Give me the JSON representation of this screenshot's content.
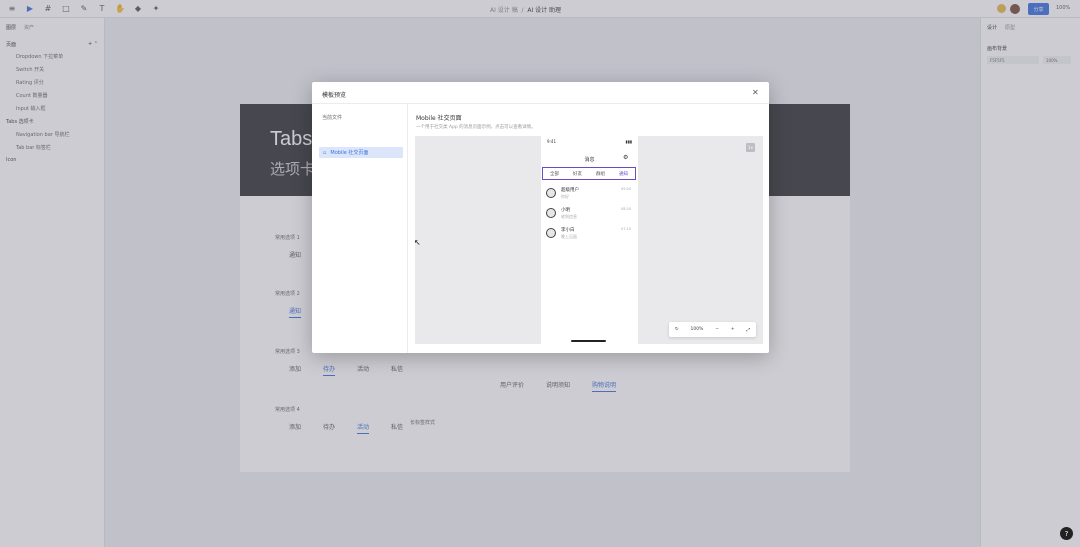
{
  "topbar": {
    "tools": [
      {
        "name": "menu-icon",
        "glyph": "≡"
      },
      {
        "name": "move-tool-icon",
        "glyph": "▶"
      },
      {
        "name": "frame-tool-icon",
        "glyph": "#"
      },
      {
        "name": "shape-tool-icon",
        "glyph": "□"
      },
      {
        "name": "pen-tool-icon",
        "glyph": "✎"
      },
      {
        "name": "text-tool-icon",
        "glyph": "T"
      },
      {
        "name": "hand-tool-icon",
        "glyph": "✋"
      },
      {
        "name": "component-tool-icon",
        "glyph": "◆"
      },
      {
        "name": "plugin-tool-icon",
        "glyph": "✦"
      }
    ],
    "doc_path": "AI 设计 稿",
    "doc_name": "AI 设计 助理",
    "share_label": "分享",
    "zoom": "100%"
  },
  "left_panel": {
    "tabs": [
      "图层",
      "资产"
    ],
    "section": "页面",
    "layers": [
      {
        "label": "Dropdown 下拉菜单",
        "kind": "sub"
      },
      {
        "label": "Switch 开关",
        "kind": "sub"
      },
      {
        "label": "Rating 评分",
        "kind": "sub"
      },
      {
        "label": "Count 数量器",
        "kind": "sub"
      },
      {
        "label": "Input 输入框",
        "kind": "sub"
      },
      {
        "label": "Tabs 选项卡",
        "kind": "grp"
      },
      {
        "label": "Navigation bar 导航栏",
        "kind": "sub"
      },
      {
        "label": "Tab bar 标签栏",
        "kind": "sub"
      },
      {
        "label": "Icon",
        "kind": "grp"
      }
    ]
  },
  "right_panel": {
    "tabs": [
      "设计",
      "原型"
    ],
    "section": "画布背景",
    "fill": "F5F5F5",
    "opacity": "100%"
  },
  "canvas": {
    "banner_title": "Tabs",
    "banner_sub": "选项卡",
    "sections": [
      {
        "label": "常用选项 1",
        "tabs": [
          "通知"
        ],
        "active": -1
      },
      {
        "label": "常用选项 2",
        "tabs": [
          "通知"
        ],
        "active": 0
      },
      {
        "label": "常用选项 3",
        "tabs": [
          "添加",
          "待办",
          "活动",
          "私信"
        ],
        "active": 1
      },
      {
        "label": "常用选项 4",
        "tabs": [
          "添加",
          "待办",
          "活动",
          "私信"
        ],
        "active": 2
      }
    ],
    "right_tabs": [
      "用户评价",
      "说明须知",
      "购物说明"
    ],
    "right_label": "长标签样式"
  },
  "modal": {
    "title": "模板预览",
    "side_head": "当前文件",
    "side_item": "Mobile 社交页面",
    "body_title": "Mobile 社交页面",
    "body_desc": "一个用于社交类 App 的消息页面示例，点击可以查看详情。",
    "phone": {
      "time": "9:41",
      "signal": "▮▮▮",
      "title": "消息",
      "tabs": [
        "全部",
        "好友",
        "群组",
        "通知"
      ],
      "active_tab": 3,
      "chats": [
        {
          "name": "超级用户",
          "msg": "你好",
          "time": "09:20"
        },
        {
          "name": "小明",
          "msg": "收到信息",
          "time": "08:20"
        },
        {
          "name": "李小白",
          "msg": "晚上见面",
          "time": "07:10"
        }
      ]
    },
    "badge": "1x",
    "toolbar": {
      "zoom": "100%",
      "minus": "−",
      "plus": "+"
    }
  },
  "colors": {
    "accent": "#3b6fe0",
    "phone_tab_border": "#6a4bc4"
  }
}
